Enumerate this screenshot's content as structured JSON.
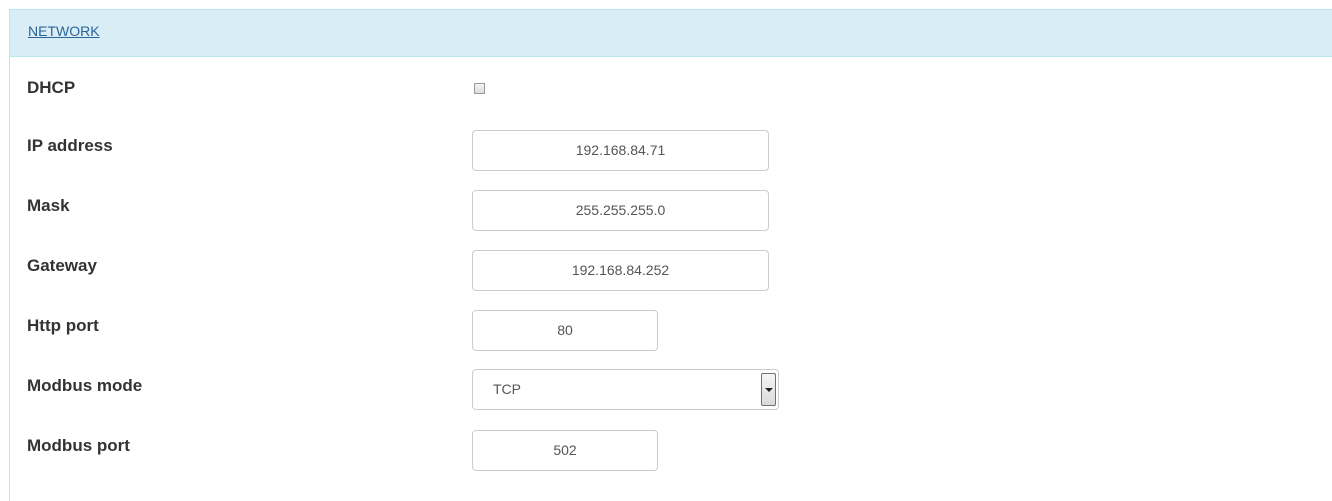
{
  "panel": {
    "title": "NETWORK"
  },
  "fields": {
    "dhcp": {
      "label": "DHCP",
      "checked": false
    },
    "ip_address": {
      "label": "IP address",
      "value": "192.168.84.71"
    },
    "mask": {
      "label": "Mask",
      "value": "255.255.255.0"
    },
    "gateway": {
      "label": "Gateway",
      "value": "192.168.84.252"
    },
    "http_port": {
      "label": "Http port",
      "value": "80"
    },
    "modbus_mode": {
      "label": "Modbus mode",
      "selected": "TCP"
    },
    "modbus_port": {
      "label": "Modbus port",
      "value": "502"
    }
  },
  "colors": {
    "heading_background": "#d9edf7",
    "heading_border": "#bce8f1",
    "link": "#2a6496"
  }
}
